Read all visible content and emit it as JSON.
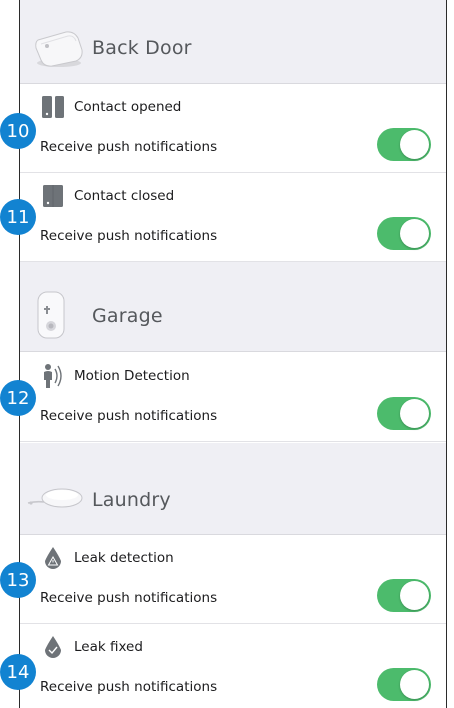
{
  "colors": {
    "toggle_on": "#4cbb6c",
    "badge": "#1283d1",
    "section_bg": "#efeff4"
  },
  "sections": [
    {
      "name": "Back Door",
      "icon": "door-contact-sensor-icon",
      "events": [
        {
          "label": "Contact opened",
          "icon": "contact-opened-icon",
          "push_label": "Receive push notifications",
          "enabled": true,
          "badge": "10"
        },
        {
          "label": "Contact closed",
          "icon": "contact-closed-icon",
          "push_label": "Receive push notifications",
          "enabled": true,
          "badge": "11"
        }
      ]
    },
    {
      "name": "Garage",
      "icon": "motion-sensor-icon",
      "events": [
        {
          "label": "Motion Detection",
          "icon": "motion-detection-icon",
          "push_label": "Receive push notifications",
          "enabled": true,
          "badge": "12"
        }
      ]
    },
    {
      "name": "Laundry",
      "icon": "leak-sensor-icon",
      "events": [
        {
          "label": "Leak detection",
          "icon": "leak-detection-icon",
          "push_label": "Receive push notifications",
          "enabled": true,
          "badge": "13"
        },
        {
          "label": "Leak fixed",
          "icon": "leak-fixed-icon",
          "push_label": "Receive push notifications",
          "enabled": true,
          "badge": "14"
        }
      ]
    }
  ]
}
